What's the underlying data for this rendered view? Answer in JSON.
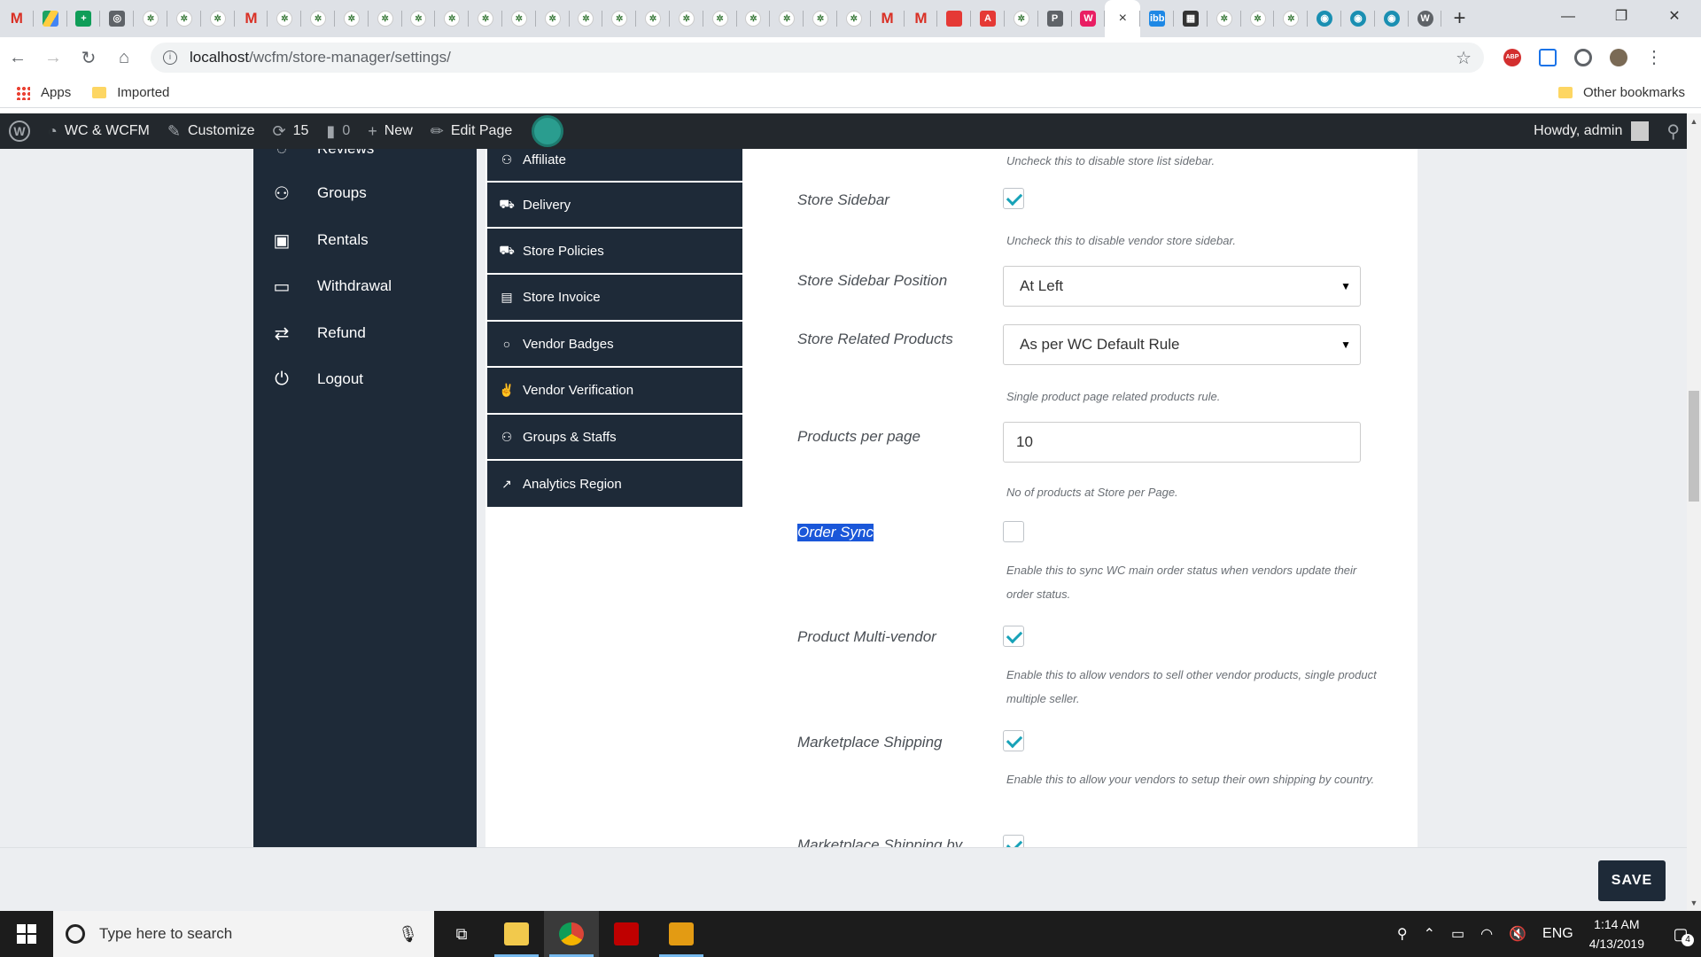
{
  "browser": {
    "tabs": [
      {
        "icon": "gmail-icon",
        "glyph": "M"
      },
      {
        "icon": "drive-icon",
        "glyph": ""
      },
      {
        "icon": "sheets-icon",
        "glyph": "+"
      },
      {
        "icon": "inbox-icon",
        "glyph": "◎"
      },
      {
        "icon": "site-icon",
        "glyph": "✲"
      },
      {
        "icon": "site-icon",
        "glyph": "✲"
      },
      {
        "icon": "site-icon",
        "glyph": "✲"
      },
      {
        "icon": "gmail-icon",
        "glyph": "M"
      },
      {
        "icon": "site-icon",
        "glyph": "✲"
      },
      {
        "icon": "site-icon",
        "glyph": "✲"
      },
      {
        "icon": "site-icon",
        "glyph": "✲"
      },
      {
        "icon": "site-icon",
        "glyph": "✲"
      },
      {
        "icon": "site-icon",
        "glyph": "✲"
      },
      {
        "icon": "site-icon",
        "glyph": "✲"
      },
      {
        "icon": "site-icon",
        "glyph": "✲"
      },
      {
        "icon": "site-icon",
        "glyph": "✲"
      },
      {
        "icon": "site-icon",
        "glyph": "✲"
      },
      {
        "icon": "site-icon",
        "glyph": "✲"
      },
      {
        "icon": "site-icon",
        "glyph": "✲"
      },
      {
        "icon": "site-icon",
        "glyph": "✲"
      },
      {
        "icon": "site-icon",
        "glyph": "✲"
      },
      {
        "icon": "site-icon",
        "glyph": "✲"
      },
      {
        "icon": "site-icon",
        "glyph": "✲"
      },
      {
        "icon": "site-icon",
        "glyph": "✲"
      },
      {
        "icon": "site-icon",
        "glyph": "✲"
      },
      {
        "icon": "site-icon",
        "glyph": "✲"
      },
      {
        "icon": "gmail-icon",
        "glyph": "M"
      },
      {
        "icon": "gmail-icon",
        "glyph": "M"
      },
      {
        "icon": "red-app-icon",
        "glyph": ""
      },
      {
        "icon": "acrobat-icon",
        "glyph": "A"
      },
      {
        "icon": "site-icon",
        "glyph": "✲"
      },
      {
        "icon": "phpmyadmin-icon",
        "glyph": "P"
      },
      {
        "icon": "app-icon",
        "glyph": "W"
      }
    ],
    "active_tab_close": "×",
    "tabs_after": [
      {
        "icon": "ibb-icon",
        "glyph": "ibb"
      },
      {
        "icon": "film-icon",
        "glyph": "▦"
      },
      {
        "icon": "site-icon",
        "glyph": "✲"
      },
      {
        "icon": "site-icon",
        "glyph": "✲"
      },
      {
        "icon": "site-icon",
        "glyph": "✲"
      },
      {
        "icon": "globe-icon",
        "glyph": "◉"
      },
      {
        "icon": "globe-icon",
        "glyph": "◉"
      },
      {
        "icon": "globe-icon",
        "glyph": "◉"
      },
      {
        "icon": "wordpress-icon",
        "glyph": "W"
      }
    ],
    "new_tab": "+",
    "window_controls": [
      "—",
      "❐",
      "✕"
    ],
    "url_host": "localhost",
    "url_path": "/wcfm/store-manager/settings/",
    "bookmarks": {
      "apps": "Apps",
      "imported": "Imported",
      "other": "Other bookmarks"
    }
  },
  "adminbar": {
    "site": "WC & WCFM",
    "customize": "Customize",
    "updates": "15",
    "comments": "0",
    "new": "New",
    "edit_page": "Edit Page",
    "howdy": "Howdy, admin"
  },
  "main_menu": {
    "partial_top": "Reviews",
    "items": [
      "Groups",
      "Rentals",
      "Withdrawal",
      "Refund",
      "Logout"
    ]
  },
  "settings_menu": {
    "items": [
      "Affiliate",
      "Delivery",
      "Store Policies",
      "Store Invoice",
      "Vendor Badges",
      "Vendor Verification",
      "Groups & Staffs",
      "Analytics Region"
    ]
  },
  "form": {
    "store_list_sidebar_desc": "Uncheck this to disable store list sidebar.",
    "store_sidebar": {
      "label": "Store Sidebar",
      "checked": true,
      "desc": "Uncheck this to disable vendor store sidebar."
    },
    "store_sidebar_position": {
      "label": "Store Sidebar Position",
      "value": "At Left"
    },
    "store_related_products": {
      "label": "Store Related Products",
      "value": "As per WC Default Rule",
      "desc": "Single product page related products rule."
    },
    "products_per_page": {
      "label": "Products per page",
      "value": "10",
      "desc": "No of products at Store per Page."
    },
    "order_sync": {
      "label": "Order Sync",
      "checked": false,
      "desc": "Enable this to sync WC main order status when vendors update their order status."
    },
    "product_multivendor": {
      "label": "Product Multi-vendor",
      "checked": true,
      "desc": "Enable this to allow vendors to sell other vendor products, single product multiple seller."
    },
    "marketplace_shipping": {
      "label": "Marketplace Shipping",
      "checked": true,
      "desc": "Enable this to allow your vendors to setup their own shipping by country."
    },
    "marketplace_shipping_by": {
      "label": "Marketplace Shipping by",
      "checked": true
    }
  },
  "save_button": "SAVE",
  "taskbar": {
    "search_placeholder": "Type here to search",
    "language": "ENG",
    "time": "1:14 AM",
    "date": "4/13/2019",
    "notifications": "4"
  }
}
